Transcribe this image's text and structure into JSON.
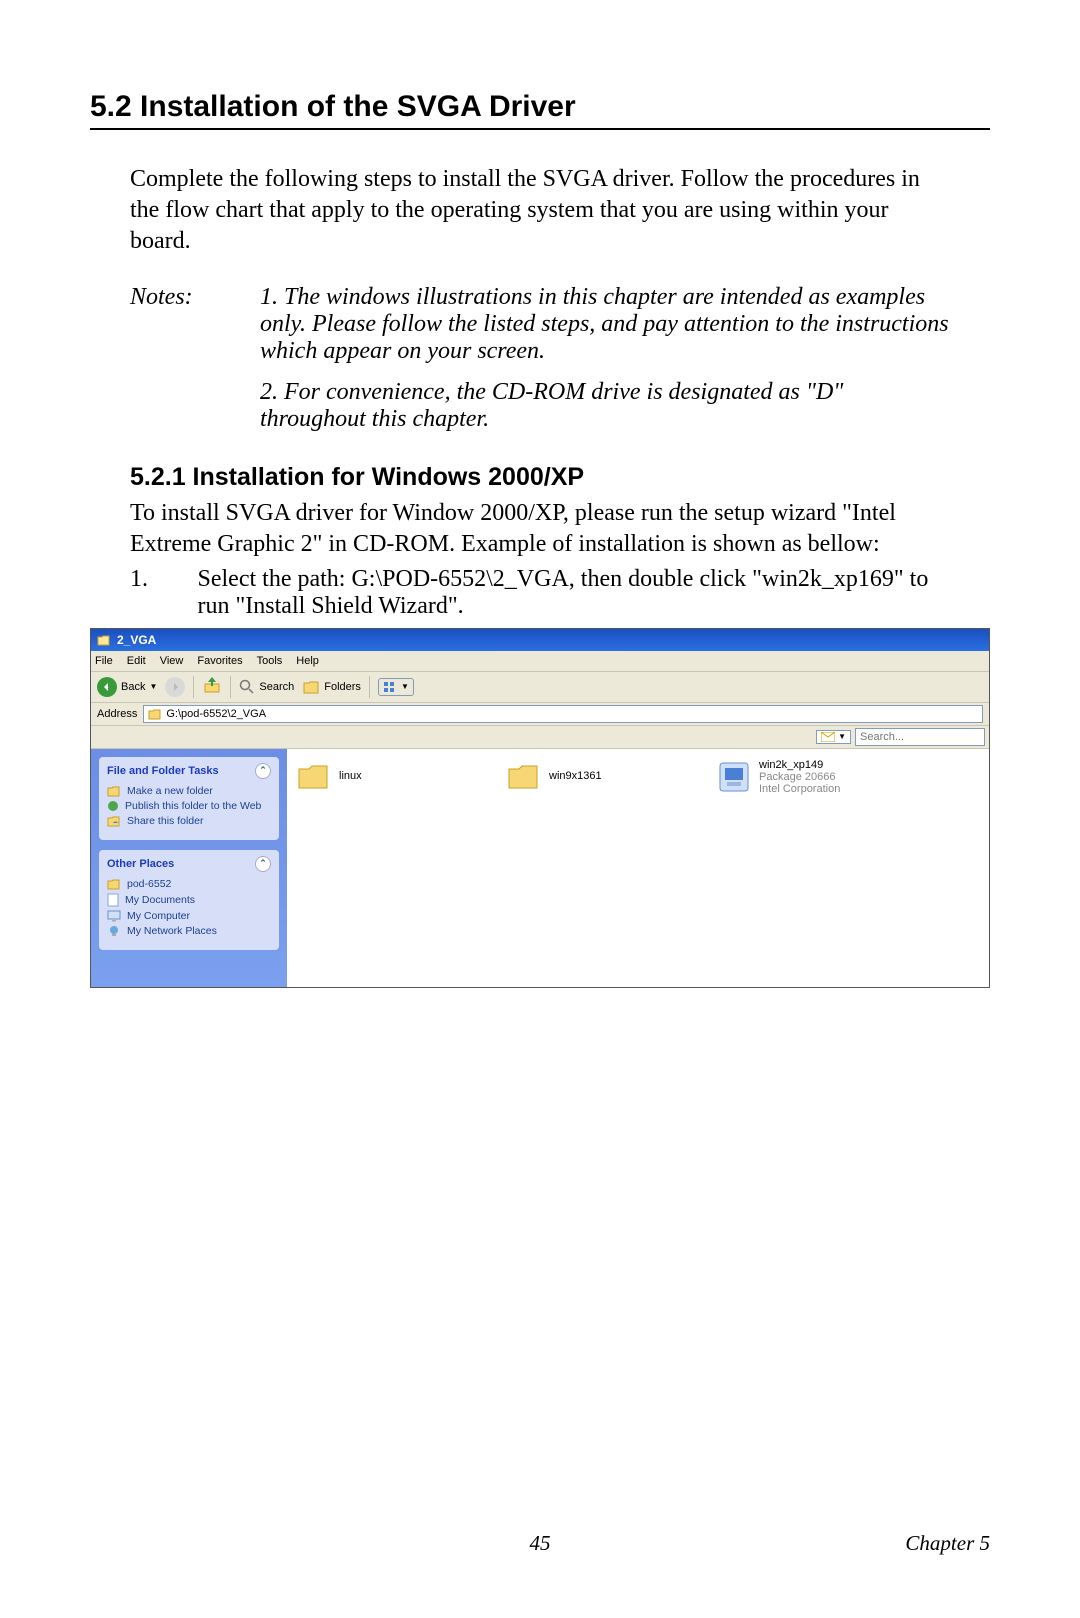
{
  "heading": "5.2  Installation of the SVGA Driver",
  "intro": "Complete the following steps to install the SVGA driver. Follow the procedures in the flow chart that apply to the operating system that you are using within your board.",
  "notes_label": "Notes:",
  "notes": [
    "1.  The windows illustrations in this chapter are intended as examples only. Please follow the listed steps, and pay attention to the instructions which appear on your screen.",
    "2.  For convenience, the CD-ROM drive is designated as \"D\" throughout this chapter."
  ],
  "subheading": "5.2.1 Installation for Windows 2000/XP",
  "subintro": "To install SVGA driver for Window 2000/XP, please run the setup wizard \"Intel Extreme Graphic 2\" in CD-ROM. Example of installation is shown as bellow:",
  "step_num": "1.",
  "step_text": "Select the path: G:\\POD-6552\\2_VGA, then double click \"win2k_xp169\" to run \"Install Shield Wizard\".",
  "explorer": {
    "title": "2_VGA",
    "menu": [
      "File",
      "Edit",
      "View",
      "Favorites",
      "Tools",
      "Help"
    ],
    "toolbar": {
      "back": "Back",
      "search": "Search",
      "folders": "Folders"
    },
    "address_label": "Address",
    "address_path": "G:\\pod-6552\\2_VGA",
    "search_placeholder": "Search...",
    "tasks": {
      "box1_title": "File and Folder Tasks",
      "box1_items": [
        "Make a new folder",
        "Publish this folder to the Web",
        "Share this folder"
      ],
      "box2_title": "Other Places",
      "box2_items": [
        "pod-6552",
        "My Documents",
        "My Computer",
        "My Network Places"
      ]
    },
    "files": [
      {
        "name": "linux"
      },
      {
        "name": "win9x1361"
      },
      {
        "name": "win2k_xp149",
        "line2": "Package 20666",
        "line3": "Intel Corporation"
      }
    ]
  },
  "footer": {
    "page": "45",
    "chapter": "Chapter 5"
  }
}
